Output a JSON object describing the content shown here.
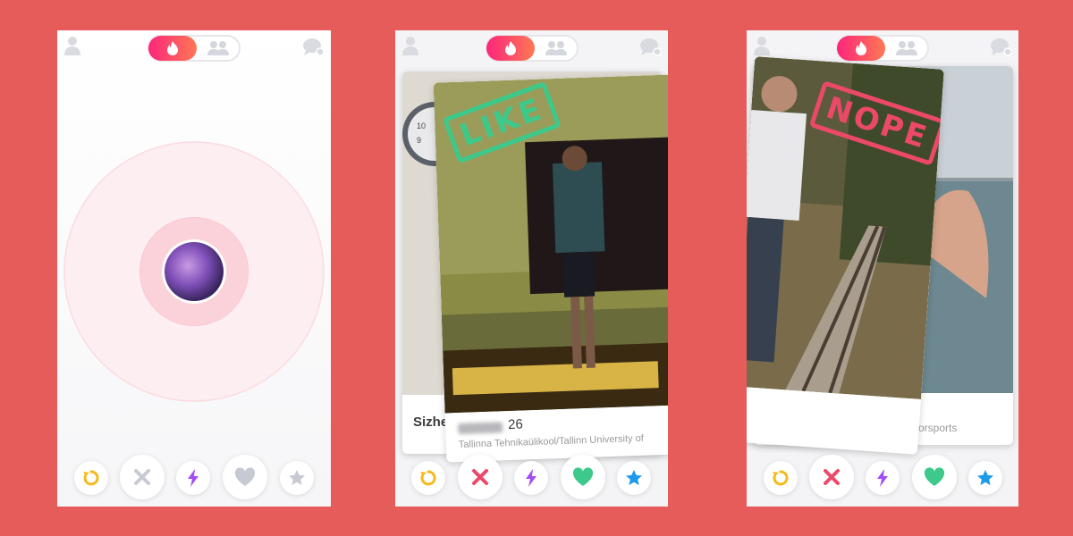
{
  "screens": [
    {
      "id": "discovery-searching",
      "state": "searching"
    },
    {
      "id": "swipe-like",
      "back_card": {
        "name": "Sizhe"
      },
      "front_card": {
        "name_blurred": true,
        "age": "26",
        "school": "Tallinna Tehnikaülikool/Tallinn University of"
      },
      "stamp": "LIKE"
    },
    {
      "id": "swipe-nope",
      "back_card": {
        "subtitle_partial": "otorsports"
      },
      "stamp": "NOPE"
    }
  ],
  "icons": {
    "top_left": "user-icon",
    "top_toggle_active": "flame-icon",
    "top_toggle_inactive": "group-icon",
    "top_right": "chat-icon",
    "actions": [
      "rewind-icon",
      "close-icon",
      "bolt-icon",
      "heart-icon",
      "star-icon"
    ]
  },
  "colors": {
    "background": "#e55c5a",
    "brand_gradient_start": "#fd267a",
    "brand_gradient_end": "#ff7854",
    "like_green": "#3dc98a",
    "nope_red": "#ec4868",
    "rewind_yellow": "#f5b91a",
    "boost_purple": "#a44df5",
    "superlike_blue": "#1e9be8",
    "inactive_gray": "#c7cad3"
  }
}
